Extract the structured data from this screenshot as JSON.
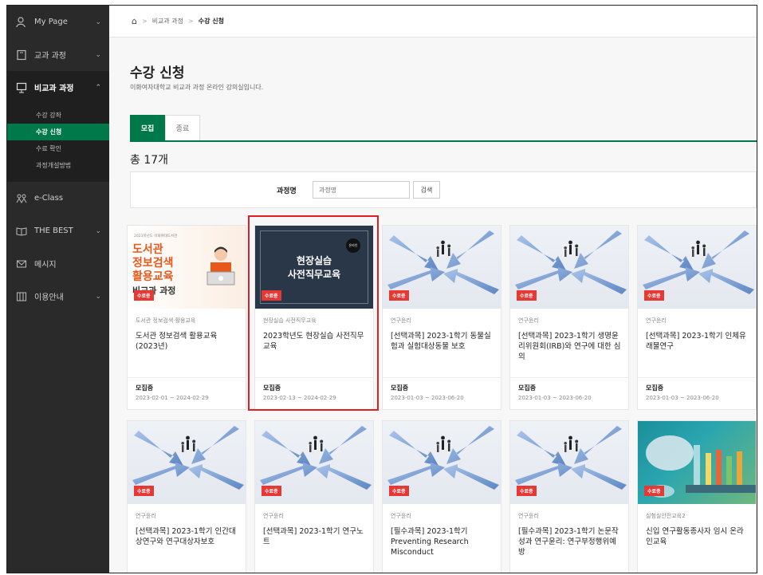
{
  "sidebar": {
    "items": [
      {
        "label": "My Page",
        "icon": "user-icon",
        "chevron": "⌄"
      },
      {
        "label": "교과 과정",
        "icon": "book-icon",
        "chevron": "⌄"
      },
      {
        "label": "비교과 과정",
        "icon": "board-icon",
        "chevron": "⌃"
      },
      {
        "label": "e-Class",
        "icon": "people-icon"
      },
      {
        "label": "THE BEST",
        "icon": "open-book-icon",
        "chevron": "⌄"
      },
      {
        "label": "메시지",
        "icon": "mail-icon"
      },
      {
        "label": "이용안내",
        "icon": "guide-icon",
        "chevron": "⌄"
      }
    ],
    "sub_items": [
      "수강 강좌",
      "수강 신청",
      "수료 확인",
      "과정개설방법"
    ]
  },
  "breadcrumb": {
    "home": "⌂",
    "sep": ">",
    "level1": "비교과 과정",
    "level2": "수강 신청"
  },
  "page": {
    "title": "수강 신청",
    "description": "이화여자대학교 비교과 과정 온라인 강의실입니다."
  },
  "tabs": [
    "모집",
    "종료"
  ],
  "total": "총 17개",
  "search": {
    "label": "과정명",
    "placeholder": "과정명",
    "button": "검색"
  },
  "badge": "수료증",
  "cards": [
    {
      "category": "도서관 정보검색·활용교육",
      "title": "도서관 정보검색 활용교육 (2023년)",
      "status": "모집중",
      "period": "2023-02-01 ~ 2024-02-29",
      "thumb": {
        "small": "2023학년도 이화여대도서관",
        "l1": "도서관",
        "l2": "정보검색",
        "l3": "활용교육",
        "l4": "비교과 과정"
      }
    },
    {
      "category": "현장실습 사전직무교육",
      "title": "2023학년도 현장실습 사전직무교육",
      "status": "모집중",
      "period": "2023-02-13 ~ 2024-02-29",
      "thumb": {
        "l1": "현장실습",
        "l2": "사전직무교육",
        "tag": "온라인"
      }
    },
    {
      "category": "연구윤리",
      "title": "[선택과목] 2023-1학기 동물실험과 실험대상동물 보호",
      "status": "모집중",
      "period": "2023-01-03 ~ 2023-06-20"
    },
    {
      "category": "연구윤리",
      "title": "[선택과목] 2023-1학기 생명윤리위원회(IRB)와 연구에 대한 심의",
      "status": "모집중",
      "period": "2023-01-03 ~ 2023-06-20"
    },
    {
      "category": "연구윤리",
      "title": "[선택과목] 2023-1학기 인체유래물연구",
      "status": "모집중",
      "period": "2023-01-03 ~ 2023-06-20"
    },
    {
      "category": "연구윤리",
      "title": "[선택과목] 2023-1학기 인간대상연구와 연구대상자보호"
    },
    {
      "category": "연구윤리",
      "title": "[선택과목] 2023-1학기 연구노트"
    },
    {
      "category": "연구윤리",
      "title": "[필수과목] 2023-1학기 Preventing Research Misconduct"
    },
    {
      "category": "연구윤리",
      "title": "[필수과목] 2023-1학기 논문작성과 연구윤리: 연구부정행위예방"
    },
    {
      "category": "실험실안전교육2",
      "title": "신입 연구활동종사자 임시 온라인교육"
    }
  ],
  "colors": {
    "accent": "#00794a",
    "badge": "#e53935",
    "sidebar": "#2a2a2a",
    "highlight": "#e02020"
  }
}
